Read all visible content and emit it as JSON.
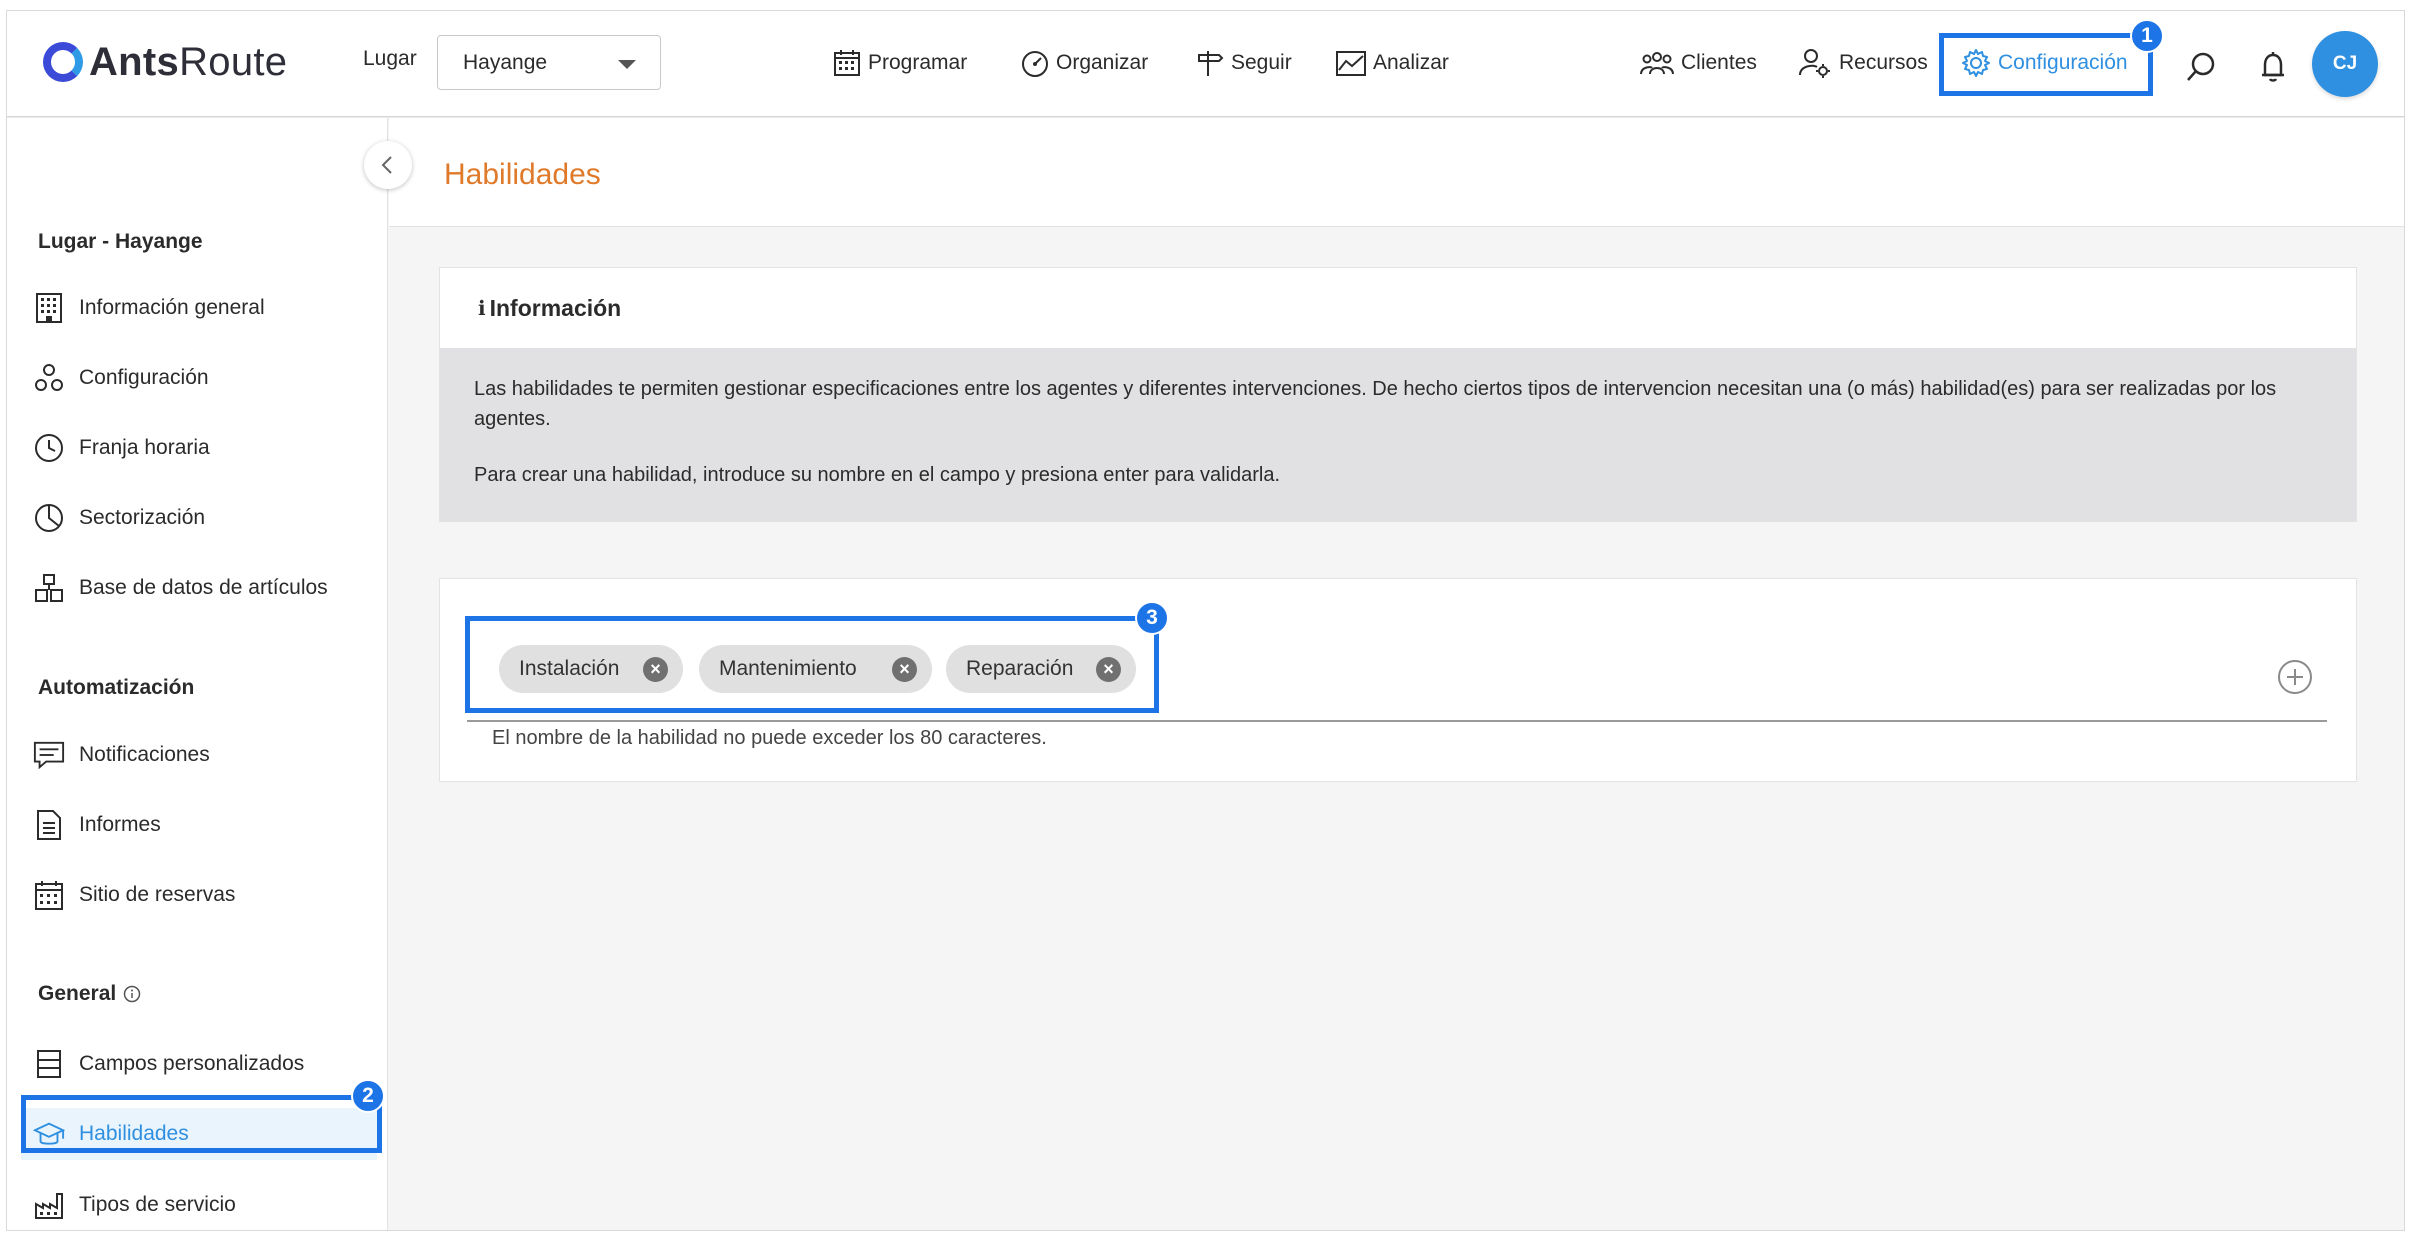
{
  "app": {
    "logo_bold": "Ants",
    "logo_rest": "Route"
  },
  "header": {
    "lugar_label": "Lugar",
    "lugar_value": "Hayange",
    "nav": [
      {
        "label": "Programar",
        "icon": "calendar-icon"
      },
      {
        "label": "Organizar",
        "icon": "speedometer-icon"
      },
      {
        "label": "Seguir",
        "icon": "signpost-icon"
      },
      {
        "label": "Analizar",
        "icon": "chart-icon"
      },
      {
        "label": "Clientes",
        "icon": "people-icon"
      },
      {
        "label": "Recursos",
        "icon": "user-gear-icon"
      },
      {
        "label": "Configuración",
        "icon": "gear-icon"
      }
    ],
    "avatar": "CJ",
    "badges": {
      "one": "1",
      "two": "2",
      "three": "3"
    }
  },
  "sidebar": {
    "section_lugar": "Lugar - Hayange",
    "lugar_items": [
      {
        "label": "Información general",
        "icon": "building-icon"
      },
      {
        "label": "Configuración",
        "icon": "cogs-icon"
      },
      {
        "label": "Franja horaria",
        "icon": "clock-icon"
      },
      {
        "label": "Sectorización",
        "icon": "pie-icon"
      },
      {
        "label": "Base de datos de artículos",
        "icon": "boxes-icon"
      }
    ],
    "section_auto": "Automatización",
    "auto_items": [
      {
        "label": "Notificaciones",
        "icon": "message-icon"
      },
      {
        "label": "Informes",
        "icon": "document-icon"
      },
      {
        "label": "Sitio de reservas",
        "icon": "calendar-grid-icon"
      }
    ],
    "section_general": "General",
    "general_items": [
      {
        "label": "Campos personalizados",
        "icon": "table-icon"
      },
      {
        "label": "Habilidades",
        "icon": "graduation-cap-icon"
      },
      {
        "label": "Tipos de servicio",
        "icon": "factory-icon"
      }
    ]
  },
  "main": {
    "title": "Habilidades",
    "info": {
      "heading": "Información",
      "paragraph1": "Las habilidades te permiten gestionar especificaciones entre los agentes y diferentes intervenciones. De hecho ciertos tipos de intervencion necesitan una (o más) habilidad(es) para ser realizadas por los agentes.",
      "paragraph2": "Para crear una habilidad, introduce su nombre en el campo y presiona enter para validarla."
    },
    "skills": [
      "Instalación",
      "Mantenimiento",
      "Reparación"
    ],
    "hint": "El nombre de la habilidad no puede exceder los 80 caracteres."
  },
  "colors": {
    "accent": "#2f8fe0",
    "title": "#e07a2b",
    "highlight": "#1d74e6"
  }
}
